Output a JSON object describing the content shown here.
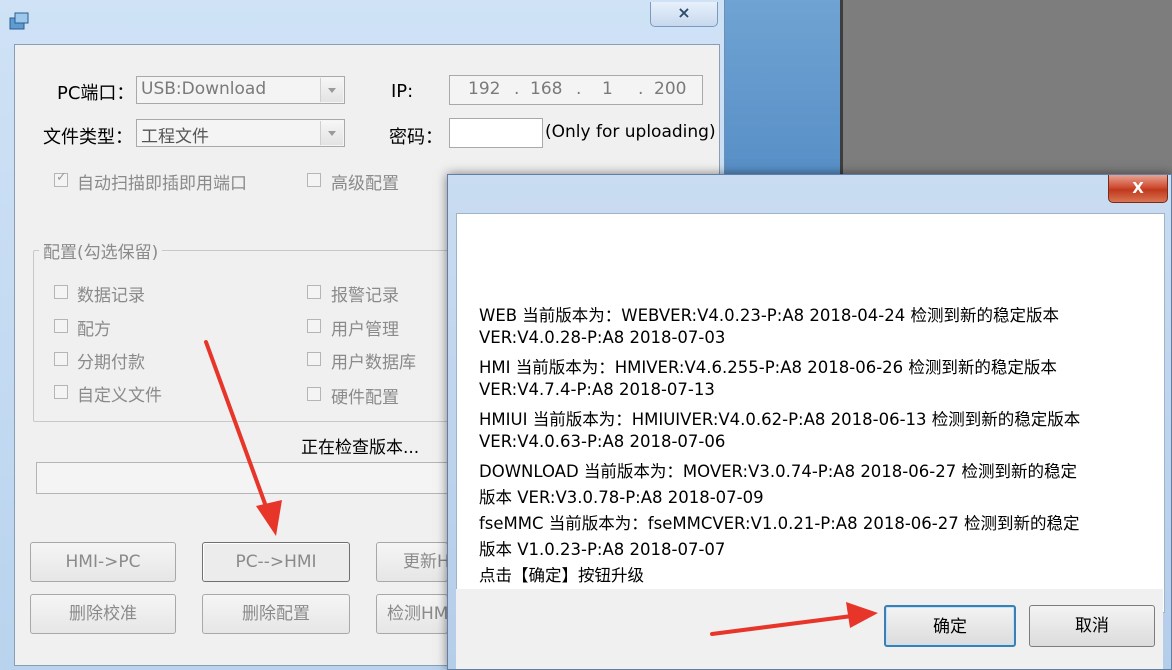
{
  "main_window": {
    "close_symbol": "⨯",
    "pc_port_label": "PC端口：",
    "pc_port_value": "USB:Download",
    "ip_label": "IP:",
    "ip_segments": [
      "192",
      "168",
      "1",
      "200"
    ],
    "file_type_label": "文件类型：",
    "file_type_value": "工程文件",
    "password_label": "密码：",
    "password_hint": "(Only for uploading)",
    "auto_scan_label": "自动扫描即插即用端口",
    "advanced_label": "高级配置",
    "config_group_title": "配置(勾选保留)",
    "config_items": {
      "data_record": "数据记录",
      "alarm_record": "报警记录",
      "recipe": "配方",
      "user_manage": "用户管理",
      "installment": "分期付款",
      "user_database": "用户数据库",
      "custom_file": "自定义文件",
      "hardware_config": "硬件配置"
    },
    "status_text": "正在检查版本...",
    "buttons": {
      "hmi_to_pc": "HMI->PC",
      "pc_to_hmi": "PC-->HMI",
      "update": "更新H",
      "delete_calibration": "删除校准",
      "delete_config": "删除配置",
      "detect": "检测HM"
    }
  },
  "dialog": {
    "close_symbol": "X",
    "lines": [
      "WEB 当前版本为：WEBVER:V4.0.23-P:A8 2018-04-24 检测到新的稳定版本",
      "VER:V4.0.28-P:A8 2018-07-03",
      "HMI 当前版本为：HMIVER:V4.6.255-P:A8 2018-06-26 检测到新的稳定版本",
      "VER:V4.7.4-P:A8 2018-07-13",
      "HMIUI 当前版本为：HMIUIVER:V4.0.62-P:A8 2018-06-13 检测到新的稳定版本",
      "VER:V4.0.63-P:A8 2018-07-06",
      "DOWNLOAD 当前版本为：MOVER:V3.0.74-P:A8 2018-06-27 检测到新的稳定",
      "版本 VER:V3.0.78-P:A8 2018-07-09",
      "fseMMC 当前版本为：fseMMCVER:V1.0.21-P:A8 2018-06-27 检测到新的稳定",
      "版本 V1.0.23-P:A8 2018-07-07",
      "点击【确定】按钮升级"
    ],
    "ok_label": "确定",
    "cancel_label": "取消"
  },
  "colors": {
    "annotation_arrow": "#e8352a",
    "dialog_close": "#c9432a",
    "window_frame": "#b9d3ee"
  }
}
